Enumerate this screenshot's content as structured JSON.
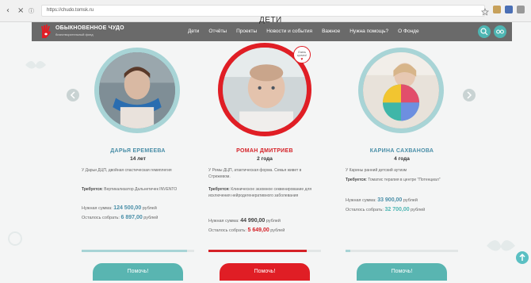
{
  "browser": {
    "url": "https://chudo.tomsk.ru"
  },
  "header": {
    "logo_title": "ОБЫКНОВЕННОЕ ЧУДО",
    "logo_subtitle": "благотворительный фонд",
    "page_heading": "ДЕТИ",
    "nav": [
      "Дети",
      "Отчёты",
      "Проекты",
      "Новости и события",
      "Важное",
      "Нужна помощь?",
      "О Фонде"
    ]
  },
  "children": [
    {
      "name": "ДАРЬЯ ЕРЕМЕЕВА",
      "age": "14 лет",
      "description": "У Дарьи ДЦП, двойная спастическая гемиплегия",
      "requires_label": "Требуется:",
      "requires": "Вертикализатор Дальнетичек INVENTO",
      "need_label": "Нужная сумма:",
      "need_amount": "124 500,00",
      "currency": "рублей",
      "left_label": "Осталось собрать:",
      "left_amount": "6 897,00",
      "progress": 0.94,
      "button": "Помочь!"
    },
    {
      "name": "РОМАН ДМИТРИЕВ",
      "age": "2 года",
      "badge": "Очень срочно!",
      "description": "У Ромы ДЦП, атактическая форма. Семья живет в Стрежевом.",
      "requires_label": "Требуется:",
      "requires": "Клиническое экзомное секвенирование для исключения нейродегенеративного заболевания",
      "need_label": "Нужная сумма:",
      "need_amount": "44 990,00",
      "currency": "рублей",
      "left_label": "Осталось собрать:",
      "left_amount": "5 649,00",
      "progress": 0.87,
      "button": "Помочь!"
    },
    {
      "name": "КАРИНА САХВАНОВА",
      "age": "4 года",
      "description": "У Карины ранний детский аутизм",
      "requires_label": "Требуется:",
      "requires": "Томатис терапия в центре \"Потенциал\"",
      "need_label": "Нужная сумма:",
      "need_amount": "33 900,00",
      "currency": "рублей",
      "left_label": "Осталось собрать:",
      "left_amount": "32 700,00",
      "progress": 0.04,
      "button": "Помочь!"
    }
  ],
  "colors": {
    "teal": "#59b5b1",
    "red": "#e01e25",
    "header": "#6a6a6a",
    "name_blue": "#4a8fa8"
  }
}
